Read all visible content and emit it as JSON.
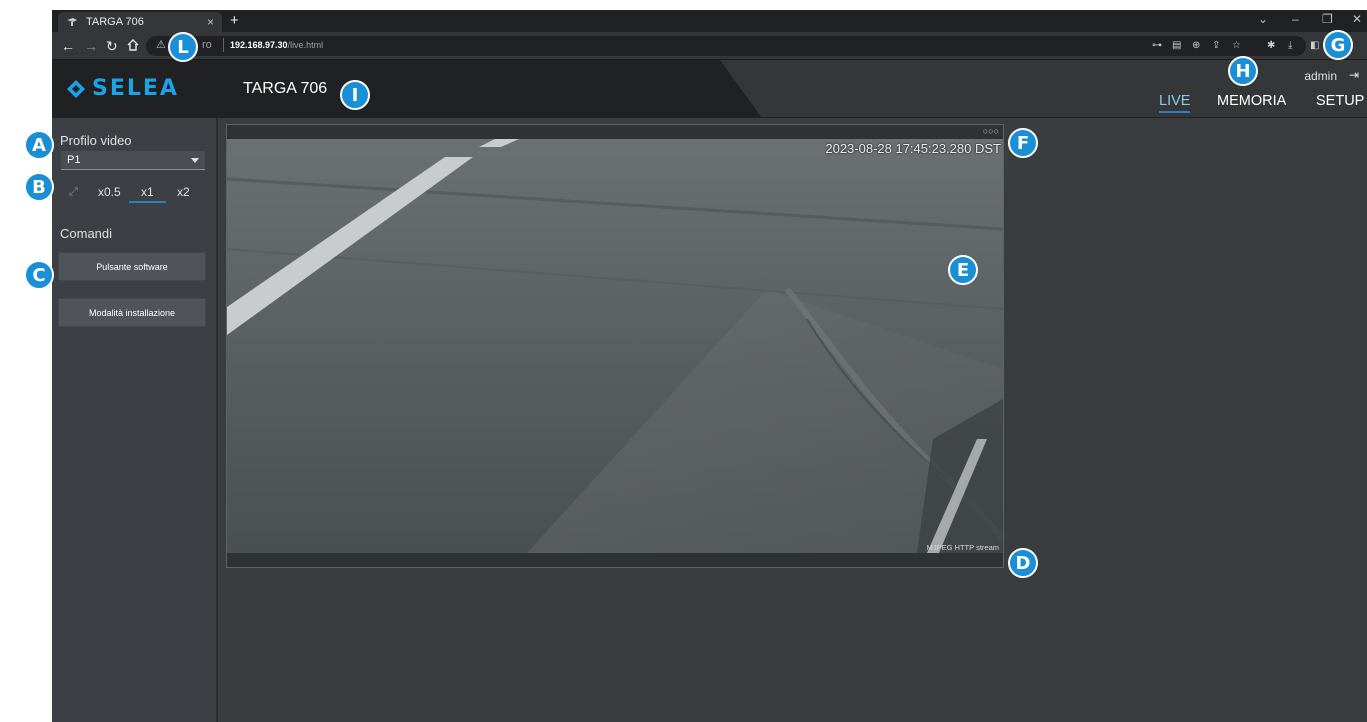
{
  "browser": {
    "tab_title": "TARGA 706",
    "tab_close": "×",
    "new_tab": "+",
    "security_label": "ro",
    "url_host": "192.168.97.30",
    "url_path": "/live.html",
    "window_controls": [
      "⌄",
      "–",
      "❐",
      "✕"
    ]
  },
  "app": {
    "brand": "SELEA",
    "title": "TARGA 706",
    "user": "admin",
    "nav": [
      {
        "label": "LIVE",
        "active": true
      },
      {
        "label": "MEMORIA",
        "active": false
      },
      {
        "label": "SETUP",
        "active": false
      }
    ]
  },
  "sidebar": {
    "profile_label": "Profilo video",
    "profile_value": "P1",
    "zoom_options": [
      "x0.5",
      "x1",
      "x2"
    ],
    "zoom_selected": "x1",
    "commands_label": "Comandi",
    "buttons": [
      "Pulsante software",
      "Modalità installazione"
    ]
  },
  "video": {
    "timestamp": "2023-08-28 17:45:23.280 DST",
    "stream_label": "MJPEG HTTP stream",
    "status_dots": "○○○"
  },
  "markers": [
    "A",
    "B",
    "C",
    "D",
    "E",
    "F",
    "G",
    "H",
    "I",
    "L"
  ],
  "colors": {
    "accent": "#1ea2e6",
    "marker": "#1b8fd6",
    "background": "#3a3d40",
    "header_dark": "#1f2123"
  }
}
